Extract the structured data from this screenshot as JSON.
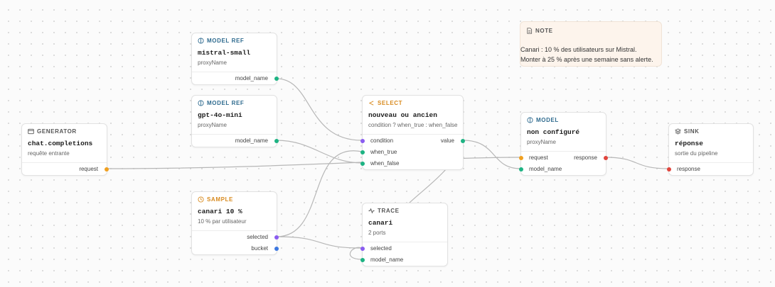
{
  "nodes": {
    "generator": {
      "type": "GENERATOR",
      "title": "chat.completions",
      "subtitle": "requête entrante",
      "ports": {
        "request": "request"
      }
    },
    "model_ref_1": {
      "type": "MODEL REF",
      "title": "mistral-small",
      "subtitle": "proxyName",
      "ports": {
        "model_name": "model_name"
      }
    },
    "model_ref_2": {
      "type": "MODEL REF",
      "title": "gpt-4o-mini",
      "subtitle": "proxyName",
      "ports": {
        "model_name": "model_name"
      }
    },
    "sample": {
      "type": "SAMPLE",
      "title": "canari 10 %",
      "subtitle": "10 % par utilisateur",
      "ports": {
        "selected": "selected",
        "bucket": "bucket"
      }
    },
    "select": {
      "type": "SELECT",
      "title": "nouveau ou ancien",
      "subtitle": "condition ? when_true : when_false",
      "ports": {
        "condition": "condition",
        "when_true": "when_true",
        "when_false": "when_false",
        "value": "value"
      }
    },
    "trace": {
      "type": "TRACE",
      "title": "canari",
      "subtitle": "2 ports",
      "ports": {
        "selected": "selected",
        "model_name": "model_name"
      }
    },
    "model": {
      "type": "MODEL",
      "title": "non configuré",
      "subtitle": "proxyName",
      "ports": {
        "request": "request",
        "model_name": "model_name",
        "response": "response"
      }
    },
    "sink": {
      "type": "SINK",
      "title": "réponse",
      "subtitle": "sortie du pipeline",
      "ports": {
        "response": "response"
      }
    }
  },
  "note": {
    "type": "NOTE",
    "line1": "Canari : 10 % des utilisateurs sur Mistral.",
    "line2": "Monter à 25 % après une semaine sans alerte."
  },
  "colors": {
    "port_orange": "#f0a020",
    "port_green": "#1db383",
    "port_purple": "#8a5cf0",
    "port_blue": "#3d78e0",
    "port_red": "#e0453d",
    "header_blue": "#2f6b8f",
    "header_orange": "#d88a1e",
    "edge": "#b7b7b7"
  },
  "icons": {
    "generator": "window-icon",
    "model_ref": "brain-icon",
    "sample": "clock-icon",
    "select": "branch-icon",
    "trace": "pulse-icon",
    "model": "brain-icon",
    "sink": "layers-icon",
    "note": "document-icon"
  }
}
